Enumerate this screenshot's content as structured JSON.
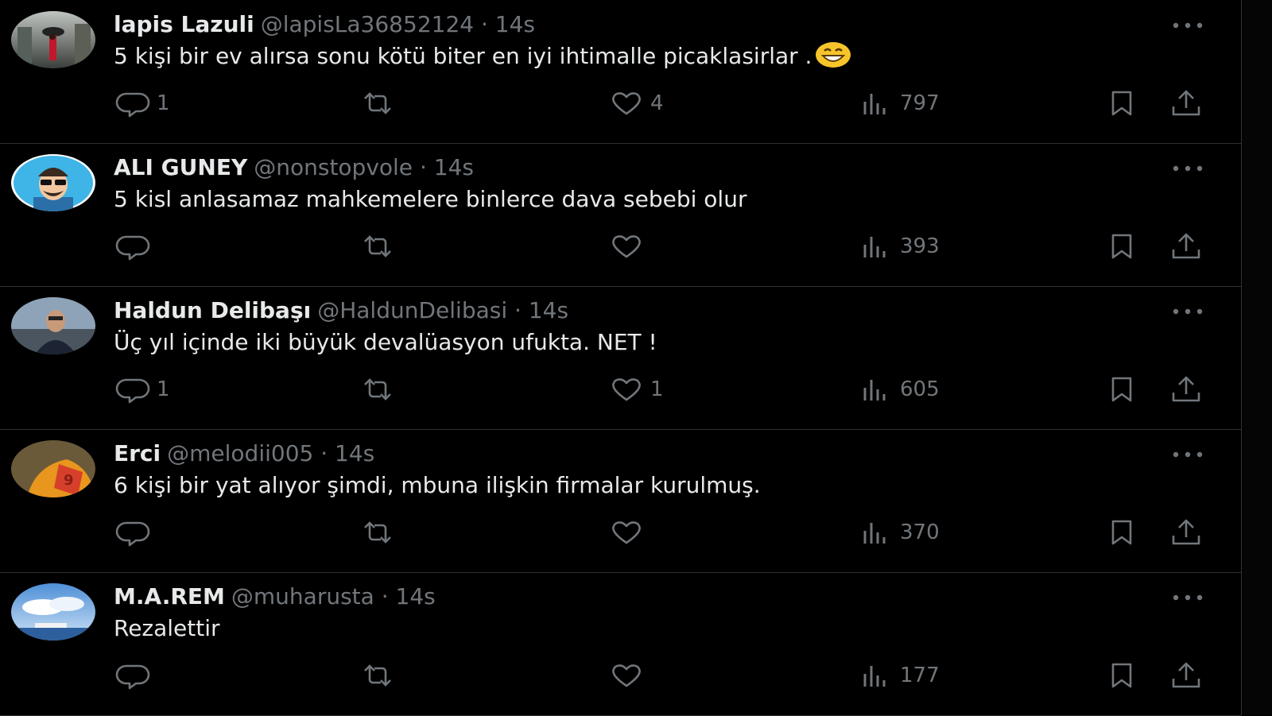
{
  "tweets": [
    {
      "name": "lapis Lazuli",
      "handle": "@lapisLa36852124",
      "time": "· 14s",
      "text": "5 kişi bir ev alırsa sonu kötü biter en iyi ihtimalle picaklasirlar .",
      "emoji": "grinning-face-emoji",
      "replies": "1",
      "retweets": "",
      "likes": "4",
      "views": "797"
    },
    {
      "name": "ALI GUNEY",
      "handle": "@nonstopvole",
      "time": "· 14s",
      "text": "5 kisl anlasamaz  mahkemelere binlerce dava sebebi olur",
      "replies": "",
      "retweets": "",
      "likes": "",
      "views": "393"
    },
    {
      "name": "Haldun Delibaşı",
      "handle": "@HaldunDelibasi",
      "time": "· 14s",
      "text": "Üç yıl içinde iki büyük devalüasyon ufukta. NET !",
      "replies": "1",
      "retweets": "",
      "likes": "1",
      "views": "605"
    },
    {
      "name": "Erci",
      "handle": "@melodii005",
      "time": "· 14s",
      "text": "6 kişi bir yat alıyor şimdi, mbuna ilişkin firmalar kurulmuş.",
      "replies": "",
      "retweets": "",
      "likes": "",
      "views": "370"
    },
    {
      "name": "M.A.REM",
      "handle": "@muharusta",
      "time": "· 14s",
      "text": "Rezalettir",
      "replies": "",
      "retweets": "",
      "likes": "",
      "views": "177"
    }
  ],
  "icons": {
    "reply": "reply-icon",
    "retweet": "retweet-icon",
    "like": "heart-icon",
    "views": "views-icon",
    "bookmark": "bookmark-icon",
    "share": "share-icon",
    "more": "more-options-icon"
  },
  "colors": {
    "background": "#000000",
    "text": "#e7e9ea",
    "muted": "#71767b",
    "divider": "#2f3336"
  }
}
